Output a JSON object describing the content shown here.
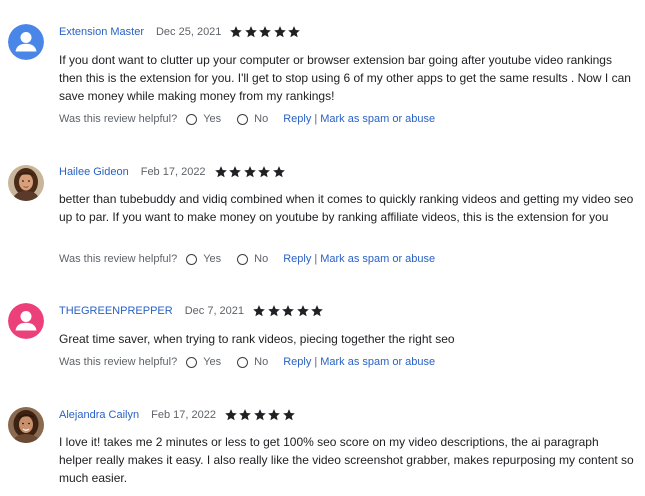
{
  "helpful_question": "Was this review helpful?",
  "yes_label": "Yes",
  "no_label": "No",
  "reply_label": "Reply",
  "separator": "|",
  "spam_label": "Mark as spam or abuse",
  "colors": {
    "link": "#2a62c4",
    "star": "#202124",
    "avatar_blue": "#4a86e8",
    "avatar_pink": "#ec407a"
  },
  "reviews": [
    {
      "author": "Extension Master",
      "date": "Dec 25, 2021",
      "rating": 5,
      "avatar_icon": "person-icon",
      "text": "If you dont want to clutter up your computer or browser extension bar going after youtube video rankings then this is the extension for you.  I'll get to stop using 6 of my other apps to get the same results .  Now I can save money while making money from my rankings!"
    },
    {
      "author": "Hailee Gideon",
      "date": "Feb 17, 2022",
      "rating": 5,
      "avatar_icon": "profile-photo",
      "text": "better than tubebuddy and vidiq combined when it comes to quickly ranking videos and getting my video seo up to par.  If you want to make money on youtube by ranking affiliate videos, this is the extension for you"
    },
    {
      "author": "THEGREENPREPPER",
      "date": "Dec 7, 2021",
      "rating": 5,
      "avatar_icon": "person-icon",
      "text": "Great time saver, when trying to rank videos, piecing together the right seo"
    },
    {
      "author": "Alejandra Cailyn",
      "date": "Feb 17, 2022",
      "rating": 5,
      "avatar_icon": "profile-photo",
      "text": "I love it! takes me 2 minutes or less to get 100% seo score on my video descriptions, the ai paragraph helper really makes it easy.  I also really like the video screenshot grabber, makes repurposing my content so much easier."
    }
  ]
}
